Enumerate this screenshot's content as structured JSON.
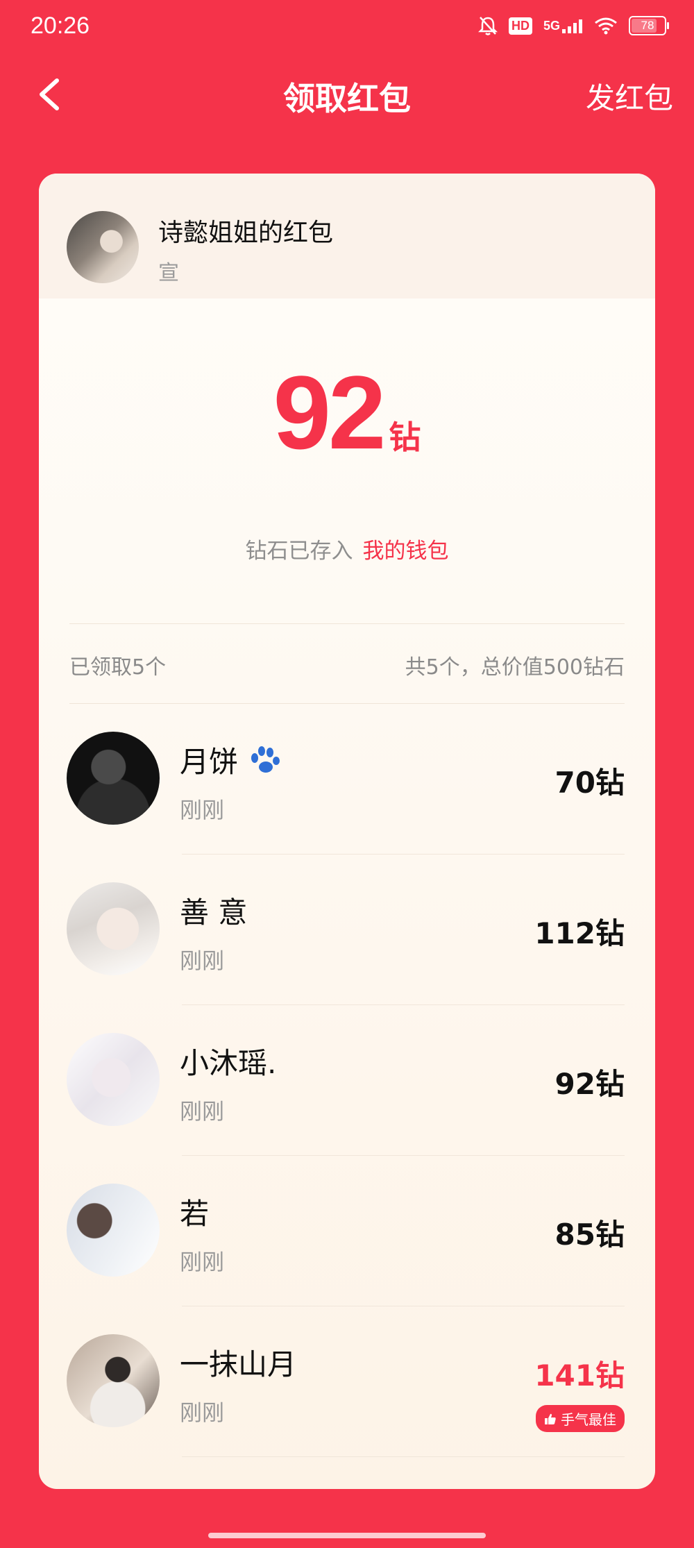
{
  "status_bar": {
    "time": "20:26",
    "hd_label": "HD",
    "signal_label": "5G",
    "battery_level": "78"
  },
  "nav": {
    "title": "领取红包",
    "right_action": "发红包"
  },
  "envelope": {
    "sender_name": "诗懿姐姐的红包",
    "sender_sub": "宣",
    "received_amount": "92",
    "amount_unit": "钻",
    "wallet_text": "钻石已存入",
    "wallet_link": "我的钱包"
  },
  "summary": {
    "claimed": "已领取5个",
    "total": "共5个，总价值500钻石"
  },
  "claims": [
    {
      "name": "月饼",
      "time": "刚刚",
      "amount": "70钻"
    },
    {
      "name": "善 意",
      "time": "刚刚",
      "amount": "112钻"
    },
    {
      "name": "小沐瑶.",
      "time": "刚刚",
      "amount": "92钻"
    },
    {
      "name": "若",
      "time": "刚刚",
      "amount": "85钻"
    },
    {
      "name": "一抹山月",
      "time": "刚刚",
      "amount": "141钻",
      "badge": "手气最佳"
    }
  ],
  "colors": {
    "brand_red": "#f5334a",
    "paw_blue": "#2f6fd6"
  }
}
